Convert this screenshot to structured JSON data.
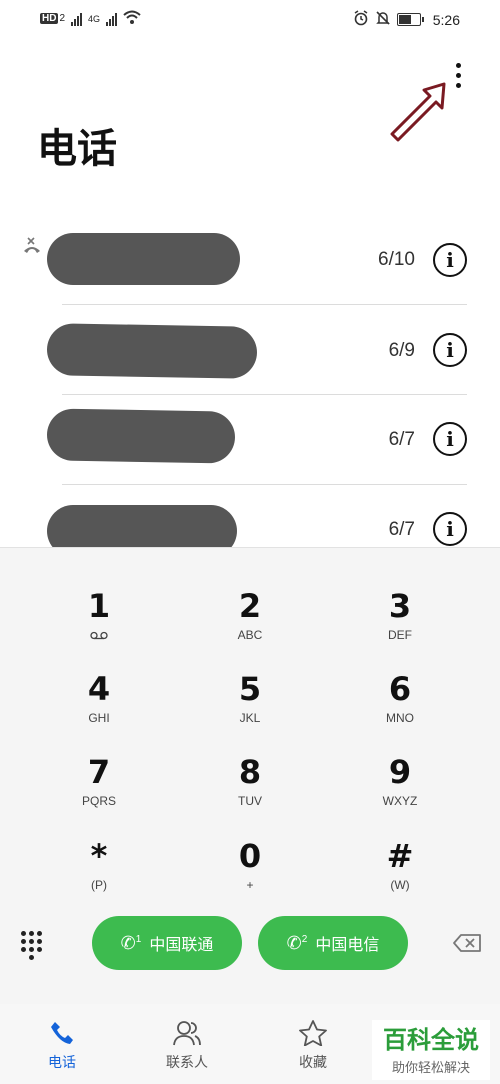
{
  "status": {
    "hd_badge": "HD",
    "sim2": "2",
    "net_type": "4G",
    "time": "5:26",
    "icons": [
      "signal-icon",
      "wifi-icon",
      "alarm-icon",
      "mute-icon",
      "battery-icon"
    ]
  },
  "header": {
    "title": "电话"
  },
  "calls": [
    {
      "date": "6/10",
      "missed": true
    },
    {
      "date": "6/9",
      "missed": false
    },
    {
      "date": "6/7",
      "missed": false
    },
    {
      "date": "6/7",
      "missed": false
    }
  ],
  "dialpad": {
    "keys": [
      {
        "digit": "1",
        "letters": ""
      },
      {
        "digit": "2",
        "letters": "ABC"
      },
      {
        "digit": "3",
        "letters": "DEF"
      },
      {
        "digit": "4",
        "letters": "GHI"
      },
      {
        "digit": "5",
        "letters": "JKL"
      },
      {
        "digit": "6",
        "letters": "MNO"
      },
      {
        "digit": "7",
        "letters": "PQRS"
      },
      {
        "digit": "8",
        "letters": "TUV"
      },
      {
        "digit": "9",
        "letters": "WXYZ"
      },
      {
        "digit": "*",
        "letters": "(P)"
      },
      {
        "digit": "0",
        "letters": "+"
      },
      {
        "digit": "#",
        "letters": "(W)"
      }
    ]
  },
  "actions": {
    "sim1_label": "中国联通",
    "sim1_num": "1",
    "sim2_label": "中国电信",
    "sim2_num": "2"
  },
  "tabs": [
    {
      "label": "电话",
      "icon": "phone-icon",
      "active": true
    },
    {
      "label": "联系人",
      "icon": "contacts-icon",
      "active": false
    },
    {
      "label": "收藏",
      "icon": "star-icon",
      "active": false
    }
  ],
  "watermark": {
    "title": "百科全说",
    "subtitle": "助你轻松解决"
  },
  "colors": {
    "accent": "#1463d9",
    "call_green": "#3dbb4f",
    "arrow": "#7a1a22"
  }
}
